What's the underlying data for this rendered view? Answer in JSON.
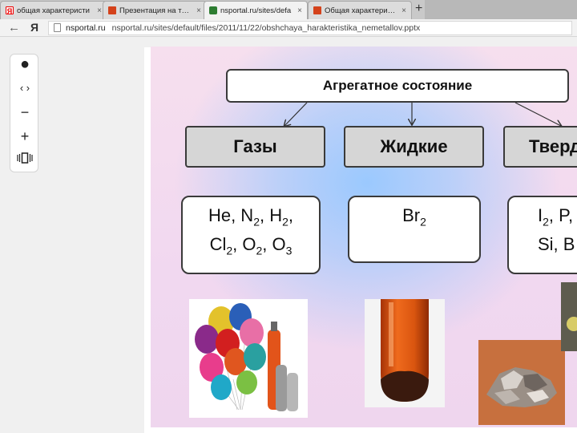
{
  "browser": {
    "tabs": [
      {
        "label": "общая характеристи",
        "icon": "yandex-icon"
      },
      {
        "label": "Презентация на тему",
        "icon": "slides-icon"
      },
      {
        "label": "nsportal.ru/sites/defa",
        "icon": "nsportal-icon",
        "active": true
      },
      {
        "label": "Общая характеристи",
        "icon": "slides-icon"
      }
    ],
    "new_tab_glyph": "+",
    "yandex_button": "Я",
    "url": {
      "domain": "nsportal.ru",
      "path": "nsportal.ru/sites/default/files/2011/11/22/obshchaya_harakteristika_nemetallov.pptx"
    }
  },
  "slide": {
    "header": "Агрегатное состояние",
    "categories": [
      {
        "label": "Газы"
      },
      {
        "label": "Жидкие"
      },
      {
        "label": "Тверд"
      }
    ],
    "examples": {
      "gases": {
        "line1": [
          {
            "t": "He, N"
          },
          {
            "s": "2"
          },
          {
            "t": ", H"
          },
          {
            "s": "2"
          },
          {
            "t": ","
          }
        ],
        "line2": [
          {
            "t": "Cl"
          },
          {
            "s": "2"
          },
          {
            "t": ", O"
          },
          {
            "s": "2"
          },
          {
            "t": ", O"
          },
          {
            "s": "3"
          }
        ]
      },
      "liquids": {
        "line1": [
          {
            "t": "Br"
          },
          {
            "s": "2"
          }
        ]
      },
      "solids": {
        "line1": [
          {
            "t": "I"
          },
          {
            "s": "2"
          },
          {
            "t": ", P,"
          }
        ],
        "line2": [
          {
            "t": "Si, B"
          }
        ]
      }
    }
  }
}
